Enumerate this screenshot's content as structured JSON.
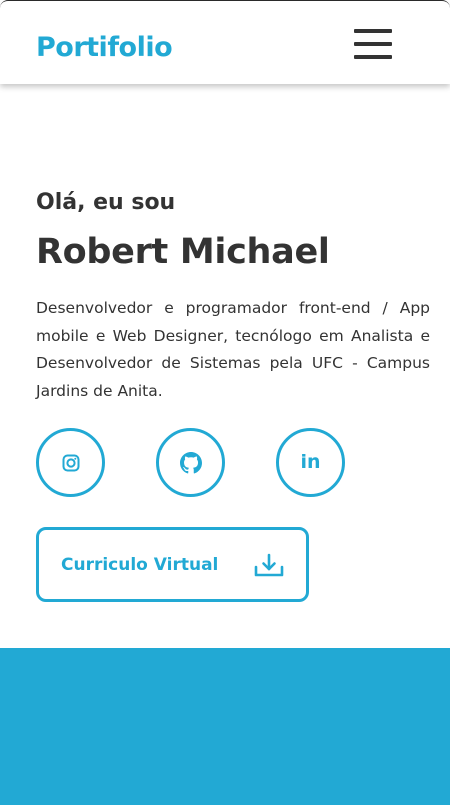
{
  "header": {
    "brand": "Portifolio",
    "menu_icon": "hamburger-menu-icon"
  },
  "hero": {
    "greeting": "Olá, eu sou",
    "name": "Robert Michael",
    "bio": "Desenvolvedor e programador front-end / App mobile e Web Designer, tecnólogo em Analista e Desenvolvedor de Sistemas pela UFC - Campus Jardins de Anita."
  },
  "social": [
    {
      "icon": "instagram-icon"
    },
    {
      "icon": "github-icon"
    },
    {
      "icon": "linkedin-icon",
      "text": "in"
    }
  ],
  "cv_button": {
    "label": "Curriculo Virtual",
    "icon": "download-icon"
  },
  "colors": {
    "accent": "#22a9d4",
    "text": "#333333",
    "background": "#ffffff"
  }
}
